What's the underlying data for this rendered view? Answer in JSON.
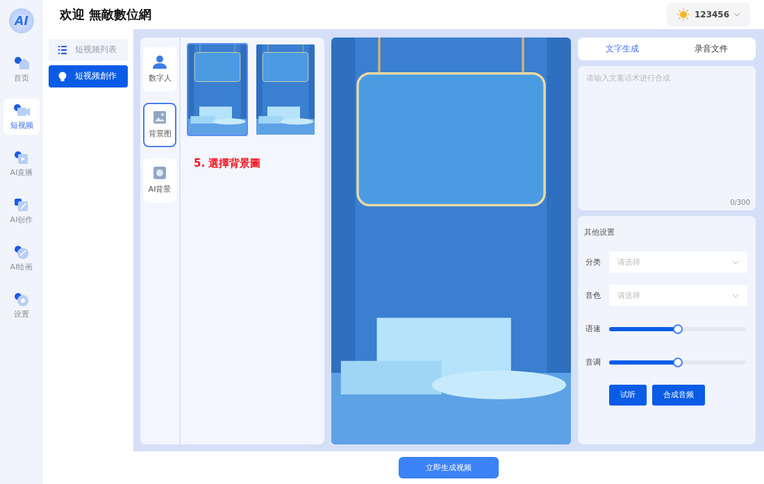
{
  "logo": {
    "text": "AI"
  },
  "rail": [
    {
      "label": "首页",
      "selected": false
    },
    {
      "label": "短视频",
      "selected": true
    },
    {
      "label": "AI直播",
      "selected": false
    },
    {
      "label": "AI创作",
      "selected": false
    },
    {
      "label": "AI绘画",
      "selected": false
    },
    {
      "label": "设置",
      "selected": false
    }
  ],
  "header": {
    "title": "欢迎 無敵數位網",
    "user": "123456"
  },
  "submenu": [
    {
      "label": "短视频列表",
      "selected": false
    },
    {
      "label": "短视频創作",
      "selected": true
    }
  ],
  "asset_tabs": [
    {
      "label": "数字人",
      "selected": false
    },
    {
      "label": "背景图",
      "selected": true
    },
    {
      "label": "AI背景",
      "selected": false
    }
  ],
  "backgrounds": [
    {
      "selected": true
    },
    {
      "selected": false
    }
  ],
  "annotation": "5. 選擇背景圖",
  "voice_tabs": [
    {
      "label": "文字生成",
      "selected": true
    },
    {
      "label": "录音文件",
      "selected": false
    }
  ],
  "script": {
    "placeholder": "请输入文案话术进行合成",
    "counter": "0/300"
  },
  "settings": {
    "title": "其他设置",
    "rows": [
      {
        "kind": "select",
        "label": "分类",
        "placeholder": "请选择"
      },
      {
        "kind": "select",
        "label": "音色",
        "placeholder": "请选择"
      },
      {
        "kind": "slider",
        "label": "语速",
        "level": 0.5
      },
      {
        "kind": "slider",
        "label": "音调",
        "level": 0.5
      }
    ],
    "buttons": [
      "试听",
      "合成音频"
    ]
  },
  "generate_button": "立即生成视频"
}
